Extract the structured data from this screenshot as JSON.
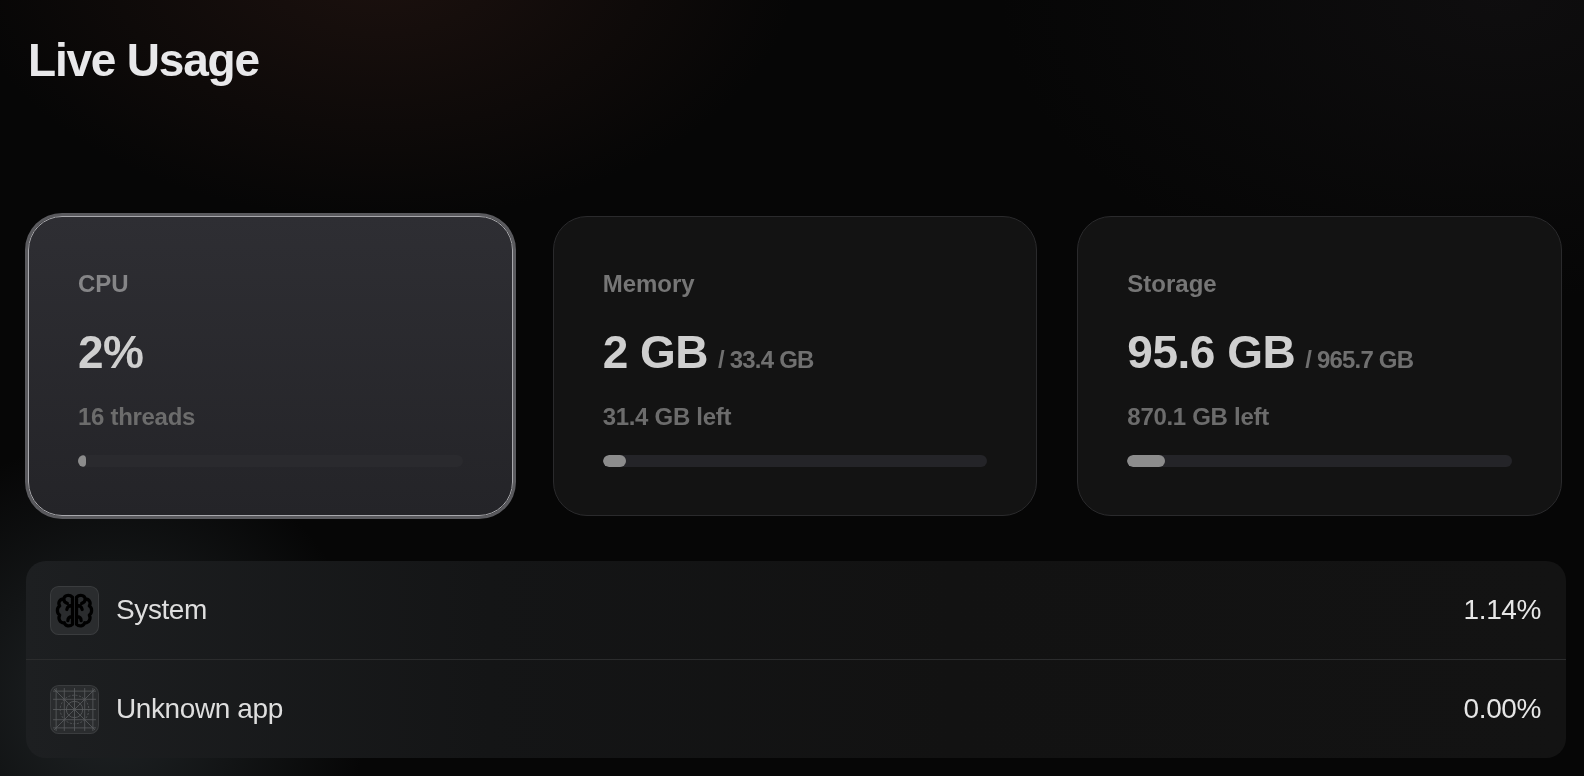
{
  "title": "Live Usage",
  "cards": [
    {
      "label": "CPU",
      "value": "2%",
      "detail": "16 threads",
      "level": 0.02,
      "selected": true
    },
    {
      "label": "Memory",
      "value": "2 GB",
      "total": "/ 33.4 GB",
      "detail": "31.4 GB left",
      "level": 0.06,
      "selected": false
    },
    {
      "label": "Storage",
      "value": "95.6 GB",
      "total": "/ 965.7 GB",
      "detail": "870.1 GB left",
      "level": 0.099,
      "selected": false
    }
  ],
  "processes": [
    {
      "kind": "system",
      "name": "System",
      "usage": "1.14%"
    },
    {
      "kind": "unknown",
      "name": "Unknown app",
      "usage": "0.00%"
    }
  ]
}
